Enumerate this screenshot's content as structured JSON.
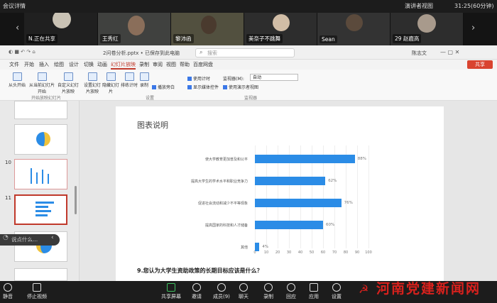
{
  "meeting": {
    "title": "会议详情",
    "time": "31:25(60分钟)",
    "presenter_view": "演讲者视图"
  },
  "participants": [
    {
      "name": "N.正在共享"
    },
    {
      "name": "王秀红"
    },
    {
      "name": ""
    },
    {
      "name": "黎沛函"
    },
    {
      "name": "美奈子不跳舞"
    },
    {
      "name": "Sean"
    },
    {
      "name": "29 赵鹿高"
    }
  ],
  "app": {
    "file": "2问卷分析.pptx • 已保存到此电脑",
    "search": "搜索",
    "user": "陈志文",
    "share": "共享"
  },
  "menus": [
    "文件",
    "开始",
    "插入",
    "绘图",
    "设计",
    "切换",
    "动画",
    "幻灯片放映",
    "录制",
    "审阅",
    "视图",
    "帮助",
    "百度网盘"
  ],
  "active_menu": "幻灯片放映",
  "ribbon": {
    "buttons": [
      "从头开始",
      "从当前幻灯片开始",
      "自定义幻灯片放映",
      "设置幻灯片放映",
      "隐藏幻灯片",
      "排练计时",
      "录制"
    ],
    "checks": [
      {
        "label": "播放旁白",
        "on": true
      },
      {
        "label": "使用计时",
        "on": true
      },
      {
        "label": "显示媒体控件",
        "on": true
      },
      {
        "label": "使用演示者视图",
        "on": true
      }
    ],
    "monitor_label": "监视器(M):",
    "monitor_value": "自动",
    "groups": [
      "开始放映幻灯片",
      "设置",
      "监视器"
    ]
  },
  "thumbs": {
    "nums": [
      "10",
      "11"
    ],
    "hint": "说点什么..."
  },
  "slide": {
    "title": "图表说明",
    "question": "9.您认为大学生资助政策的长期目标应该是什么？"
  },
  "chart_data": {
    "type": "bar",
    "orientation": "horizontal",
    "categories": [
      "使大学教育更加普及和公平",
      "提高大学生的学术水平和职业竞争力",
      "促进社会流动和减少不平等现象",
      "提高国家的科技和人才储备",
      "其他"
    ],
    "values": [
      88,
      62,
      76,
      60,
      4
    ],
    "value_labels": [
      "88%",
      "62%",
      "76%",
      "60%",
      "4%"
    ],
    "xlim": [
      0,
      100
    ],
    "ticks": [
      "0",
      "10",
      "20",
      "30",
      "40",
      "50",
      "60",
      "70",
      "80",
      "90",
      "100"
    ],
    "color": "#2b8ce6"
  },
  "toolbar": [
    "静音",
    "停止视频",
    "共享屏幕",
    "邀请",
    "成员(9)",
    "聊天",
    "录制",
    "回应",
    "应用",
    "设置"
  ],
  "logo": "河南党建新闻网"
}
